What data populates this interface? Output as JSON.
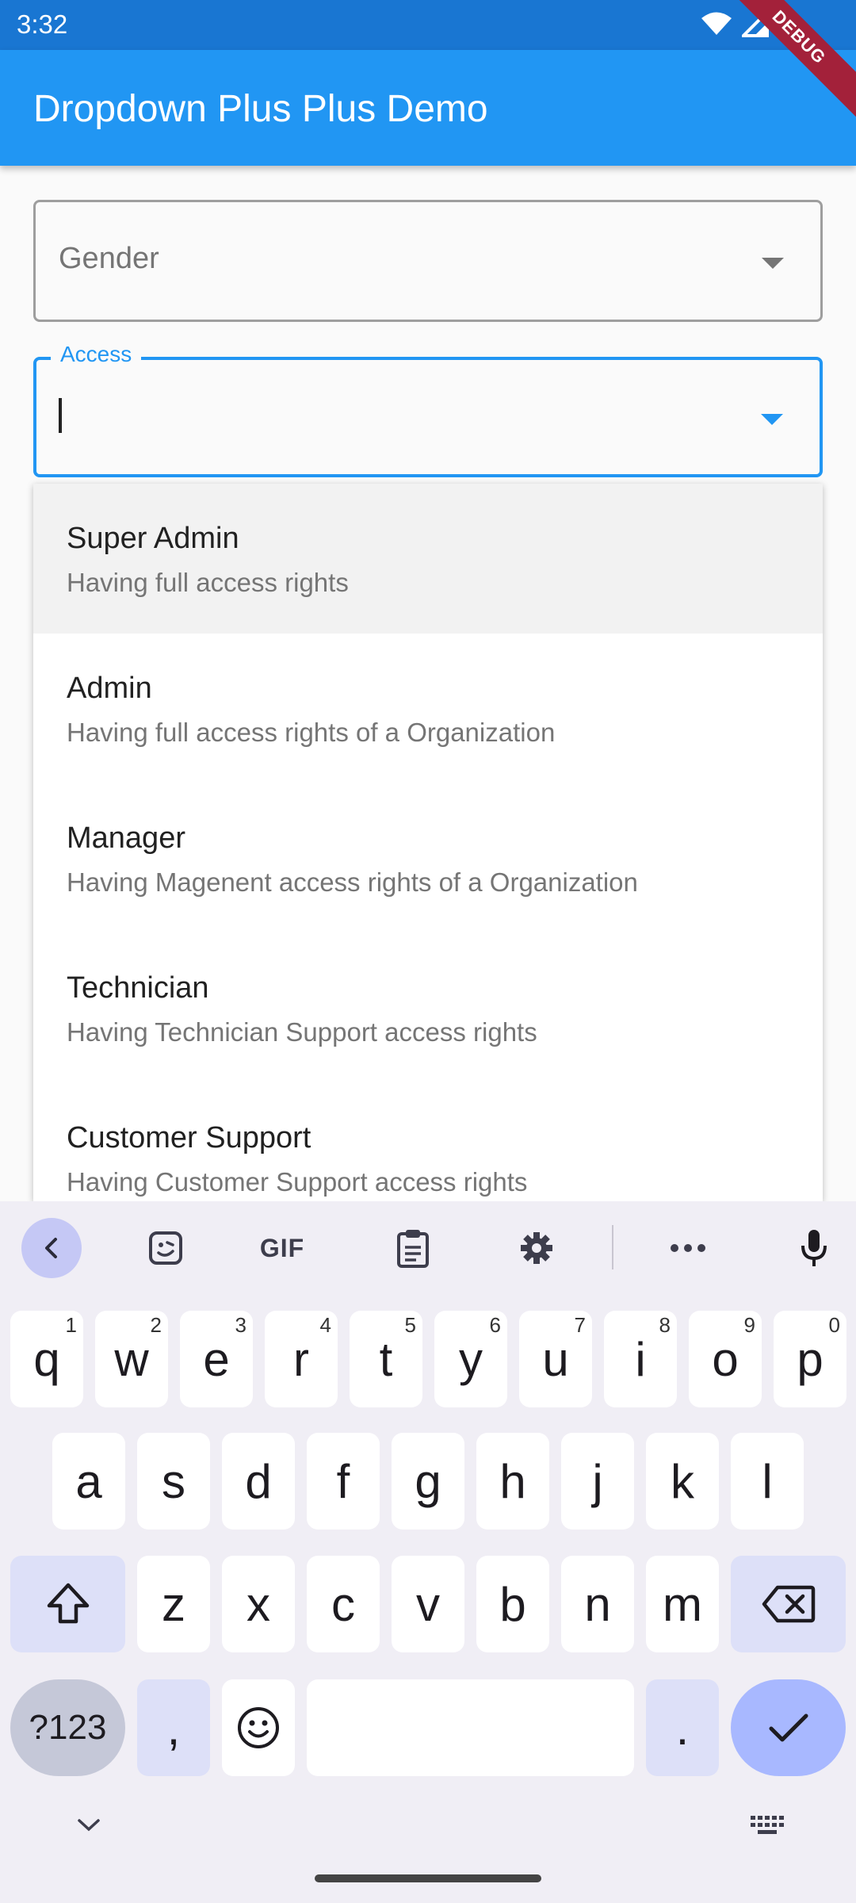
{
  "status_bar": {
    "time": "3:32"
  },
  "app_bar": {
    "title": "Dropdown Plus Plus Demo"
  },
  "debug_banner": {
    "label": "DEBUG"
  },
  "gender_field": {
    "label": "Gender"
  },
  "access_field": {
    "label": "Access",
    "value": ""
  },
  "menu": {
    "items": [
      {
        "title": "Super Admin",
        "subtitle": "Having full access rights"
      },
      {
        "title": "Admin",
        "subtitle": "Having full access rights of a Organization"
      },
      {
        "title": "Manager",
        "subtitle": "Having Magenent access rights of a Organization"
      },
      {
        "title": "Technician",
        "subtitle": "Having Technician Support access rights"
      },
      {
        "title": "Customer Support",
        "subtitle": "Having Customer Support access rights"
      }
    ]
  },
  "keyboard": {
    "toolbar_gif": "GIF",
    "row1": [
      {
        "key": "q",
        "hint": "1"
      },
      {
        "key": "w",
        "hint": "2"
      },
      {
        "key": "e",
        "hint": "3"
      },
      {
        "key": "r",
        "hint": "4"
      },
      {
        "key": "t",
        "hint": "5"
      },
      {
        "key": "y",
        "hint": "6"
      },
      {
        "key": "u",
        "hint": "7"
      },
      {
        "key": "i",
        "hint": "8"
      },
      {
        "key": "o",
        "hint": "9"
      },
      {
        "key": "p",
        "hint": "0"
      }
    ],
    "row2": [
      "a",
      "s",
      "d",
      "f",
      "g",
      "h",
      "j",
      "k",
      "l"
    ],
    "row3": [
      "z",
      "x",
      "c",
      "v",
      "b",
      "n",
      "m"
    ],
    "symbols_label": "?123",
    "comma": ",",
    "period": "."
  },
  "colors": {
    "status_bar": "#1976d2",
    "app_bar": "#2196f3",
    "accent": "#2196f3",
    "debug_banner": "#a3213a",
    "keyboard_bg": "#f0eef5",
    "enter_key": "#a8b8ff"
  }
}
